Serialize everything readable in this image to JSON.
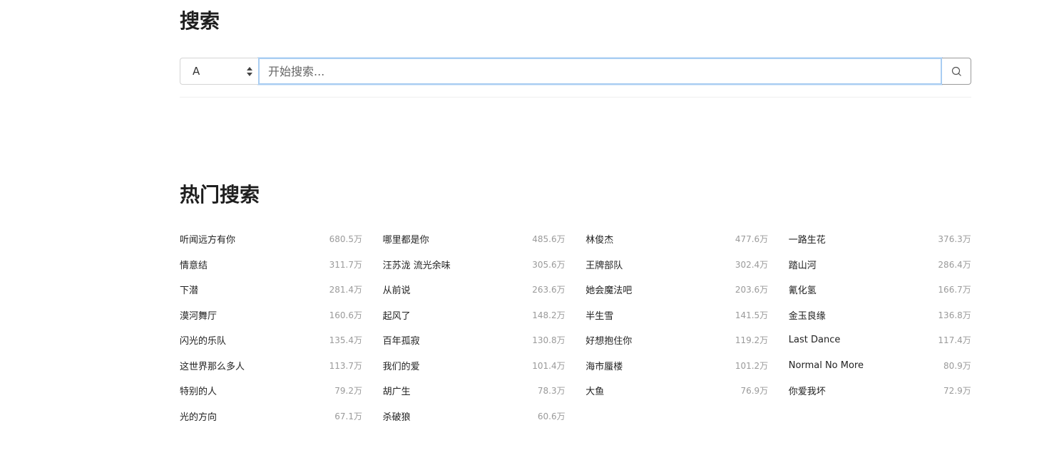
{
  "page_title": "搜索",
  "search": {
    "type_selected": "A",
    "placeholder": "开始搜索...",
    "value": ""
  },
  "icons": {
    "search_button": "search-icon",
    "select": "sort-arrows-icon"
  },
  "hot_section_title": "热门搜索",
  "hot_searches": [
    {
      "term": "听闻远方有你",
      "count": "680.5万"
    },
    {
      "term": "哪里都是你",
      "count": "485.6万"
    },
    {
      "term": "林俊杰",
      "count": "477.6万"
    },
    {
      "term": "一路生花",
      "count": "376.3万"
    },
    {
      "term": "情意结",
      "count": "311.7万"
    },
    {
      "term": "汪苏泷 流光余味",
      "count": "305.6万"
    },
    {
      "term": "王牌部队",
      "count": "302.4万"
    },
    {
      "term": "踏山河",
      "count": "286.4万"
    },
    {
      "term": "下潜",
      "count": "281.4万"
    },
    {
      "term": "从前说",
      "count": "263.6万"
    },
    {
      "term": "她会魔法吧",
      "count": "203.6万"
    },
    {
      "term": "氰化氢",
      "count": "166.7万"
    },
    {
      "term": "漠河舞厅",
      "count": "160.6万"
    },
    {
      "term": "起风了",
      "count": "148.2万"
    },
    {
      "term": "半生雪",
      "count": "141.5万"
    },
    {
      "term": "金玉良缘",
      "count": "136.8万"
    },
    {
      "term": "闪光的乐队",
      "count": "135.4万"
    },
    {
      "term": "百年孤寂",
      "count": "130.8万"
    },
    {
      "term": "好想抱住你",
      "count": "119.2万"
    },
    {
      "term": "Last Dance",
      "count": "117.4万"
    },
    {
      "term": "这世界那么多人",
      "count": "113.7万"
    },
    {
      "term": "我们的爱",
      "count": "101.4万"
    },
    {
      "term": "海市蜃楼",
      "count": "101.2万"
    },
    {
      "term": "Normal No More",
      "count": "80.9万"
    },
    {
      "term": "特别的人",
      "count": "79.2万"
    },
    {
      "term": "胡广生",
      "count": "78.3万"
    },
    {
      "term": "大鱼",
      "count": "76.9万"
    },
    {
      "term": "你爱我坏",
      "count": "72.9万"
    },
    {
      "term": "光的方向",
      "count": "67.1万"
    },
    {
      "term": "杀破狼",
      "count": "60.6万"
    }
  ]
}
